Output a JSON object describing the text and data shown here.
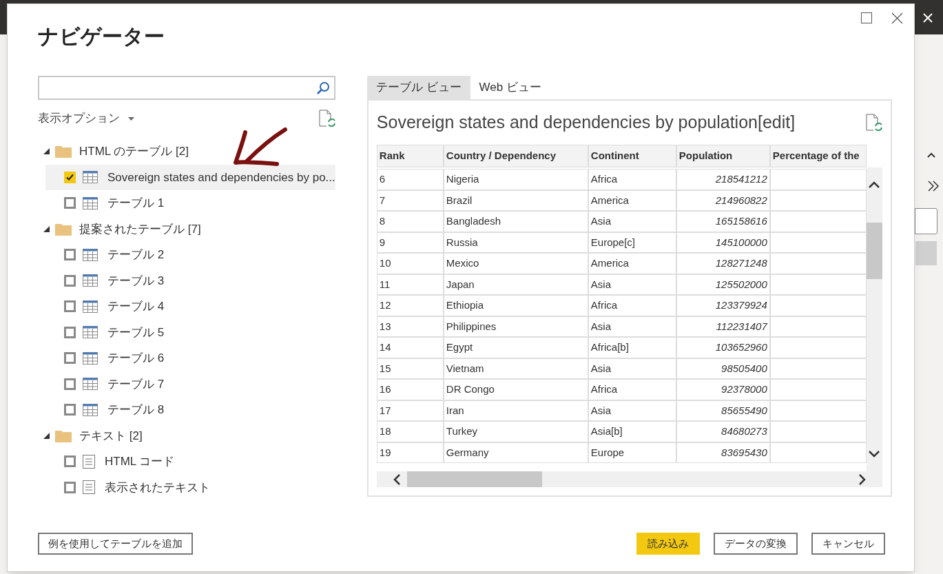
{
  "title": "ナビゲーター",
  "display_options": "表示オプション",
  "tree": [
    {
      "label": "HTML のテーブル",
      "count": "[2]",
      "expanded": true,
      "children": [
        {
          "label": "Sovereign states and dependencies by po...",
          "kind": "table",
          "checked": true,
          "selected": true
        },
        {
          "label": "テーブル 1",
          "kind": "table",
          "checked": false,
          "selected": false
        }
      ]
    },
    {
      "label": "提案されたテーブル",
      "count": "[7]",
      "expanded": true,
      "children": [
        {
          "label": "テーブル 2",
          "kind": "table",
          "checked": false,
          "selected": false
        },
        {
          "label": "テーブル 3",
          "kind": "table",
          "checked": false,
          "selected": false
        },
        {
          "label": "テーブル 4",
          "kind": "table",
          "checked": false,
          "selected": false
        },
        {
          "label": "テーブル 5",
          "kind": "table",
          "checked": false,
          "selected": false
        },
        {
          "label": "テーブル 6",
          "kind": "table",
          "checked": false,
          "selected": false
        },
        {
          "label": "テーブル 7",
          "kind": "table",
          "checked": false,
          "selected": false
        },
        {
          "label": "テーブル 8",
          "kind": "table",
          "checked": false,
          "selected": false
        }
      ]
    },
    {
      "label": "テキスト",
      "count": "[2]",
      "expanded": true,
      "children": [
        {
          "label": "HTML コード",
          "kind": "text",
          "checked": false,
          "selected": false
        },
        {
          "label": "表示されたテキスト",
          "kind": "text",
          "checked": false,
          "selected": false
        }
      ]
    }
  ],
  "preview_tabs": [
    {
      "label": "テーブル ビュー",
      "selected": true
    },
    {
      "label": "Web ビュー",
      "selected": false
    }
  ],
  "preview": {
    "title": "Sovereign states and dependencies by population[edit]",
    "columns": [
      "Rank",
      "Country / Dependency",
      "Continent",
      "Population",
      "Percentage of the"
    ],
    "rows": [
      [
        "6",
        "Nigeria",
        "Africa",
        "218541212"
      ],
      [
        "7",
        "Brazil",
        "America",
        "214960822"
      ],
      [
        "8",
        "Bangladesh",
        "Asia",
        "165158616"
      ],
      [
        "9",
        "Russia",
        "Europe[c]",
        "145100000"
      ],
      [
        "10",
        "Mexico",
        "America",
        "128271248"
      ],
      [
        "11",
        "Japan",
        "Asia",
        "125502000"
      ],
      [
        "12",
        "Ethiopia",
        "Africa",
        "123379924"
      ],
      [
        "13",
        "Philippines",
        "Asia",
        "112231407"
      ],
      [
        "14",
        "Egypt",
        "Africa[b]",
        "103652960"
      ],
      [
        "15",
        "Vietnam",
        "Asia",
        "98505400"
      ],
      [
        "16",
        "DR Congo",
        "Africa",
        "92378000"
      ],
      [
        "17",
        "Iran",
        "Asia",
        "85655490"
      ],
      [
        "18",
        "Turkey",
        "Asia[b]",
        "84680273"
      ],
      [
        "19",
        "Germany",
        "Europe",
        "83695430"
      ]
    ]
  },
  "footer": {
    "left_button": "例を使用してテーブルを追加",
    "buttons": [
      {
        "label": "読み込み",
        "kind": "primary"
      },
      {
        "label": "データの変換",
        "kind": "secondary"
      },
      {
        "label": "キャンセル",
        "kind": "secondary"
      }
    ]
  }
}
